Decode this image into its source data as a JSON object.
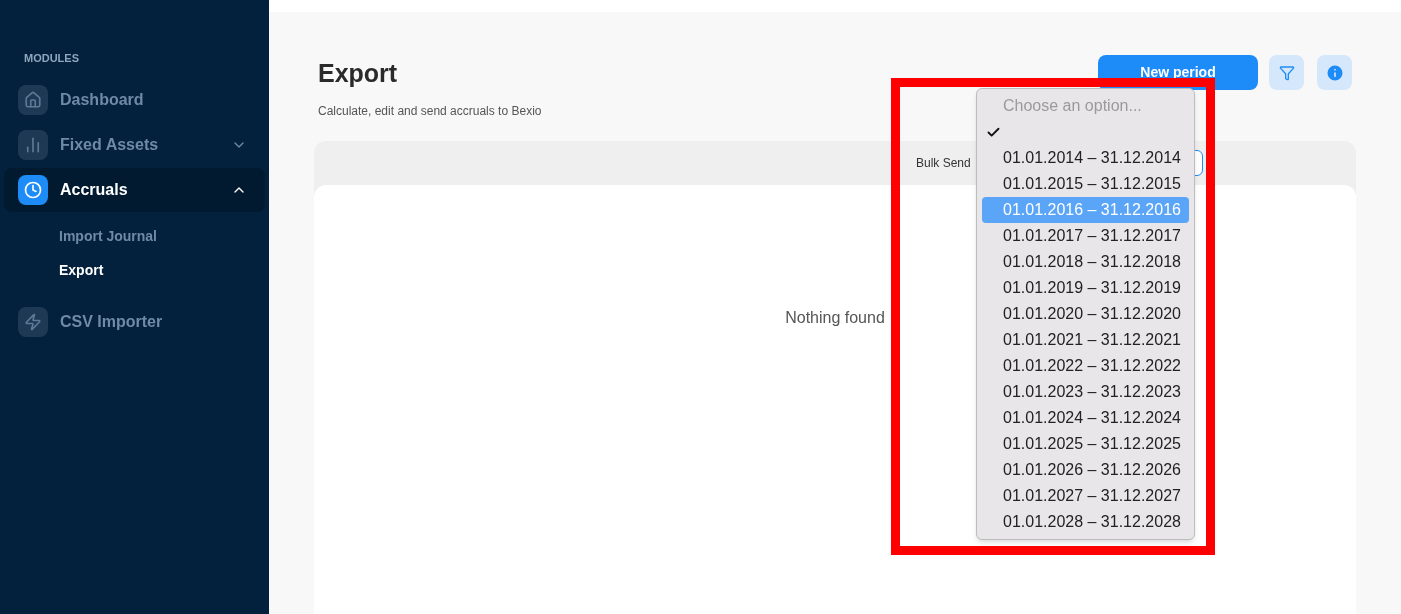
{
  "sidebar": {
    "section_title": "MODULES",
    "items": [
      {
        "label": "Dashboard",
        "selected": false
      },
      {
        "label": "Fixed Assets",
        "selected": false,
        "expanded": false
      },
      {
        "label": "Accruals",
        "selected": true,
        "expanded": true,
        "children": [
          {
            "label": "Import Journal",
            "selected": false
          },
          {
            "label": "Export",
            "selected": true
          }
        ]
      },
      {
        "label": "CSV Importer",
        "selected": false
      }
    ]
  },
  "page": {
    "title": "Export",
    "subtitle": "Calculate, edit and send accruals to Bexio",
    "primary_button": "New period",
    "empty_message": "Nothing found",
    "toolbar_label": "Bulk Send"
  },
  "dropdown": {
    "options": [
      {
        "kind": "placeholder",
        "label": "Choose an option...",
        "checked": false
      },
      {
        "kind": "option",
        "checked": true,
        "selected": false
      },
      {
        "kind": "option",
        "label": "01.01.2014 – 31.12.2014",
        "selected": false,
        "checked": false
      },
      {
        "kind": "option",
        "label": "01.01.2015 – 31.12.2015",
        "selected": false,
        "checked": false
      },
      {
        "kind": "option",
        "label": "01.01.2016 – 31.12.2016",
        "selected": true,
        "checked": false
      },
      {
        "kind": "option",
        "label": "01.01.2017 – 31.12.2017",
        "selected": false,
        "checked": false
      },
      {
        "kind": "option",
        "label": "01.01.2018 – 31.12.2018",
        "selected": false,
        "checked": false
      },
      {
        "kind": "option",
        "label": "01.01.2019 – 31.12.2019",
        "selected": false,
        "checked": false
      },
      {
        "kind": "option",
        "label": "01.01.2020 – 31.12.2020",
        "selected": false,
        "checked": false
      },
      {
        "kind": "option",
        "label": "01.01.2021 – 31.12.2021",
        "selected": false,
        "checked": false
      },
      {
        "kind": "option",
        "label": "01.01.2022 – 31.12.2022",
        "selected": false,
        "checked": false
      },
      {
        "kind": "option",
        "label": "01.01.2023 – 31.12.2023",
        "selected": false,
        "checked": false
      },
      {
        "kind": "option",
        "label": "01.01.2024 – 31.12.2024",
        "selected": false,
        "checked": false
      },
      {
        "kind": "option",
        "label": "01.01.2025 – 31.12.2025",
        "selected": false,
        "checked": false
      },
      {
        "kind": "option",
        "label": "01.01.2026 – 31.12.2026",
        "selected": false,
        "checked": false
      },
      {
        "kind": "option",
        "label": "01.01.2027 – 31.12.2027",
        "selected": false,
        "checked": false
      },
      {
        "kind": "option",
        "label": "01.01.2028 – 31.12.2028",
        "selected": false,
        "checked": false
      }
    ]
  }
}
